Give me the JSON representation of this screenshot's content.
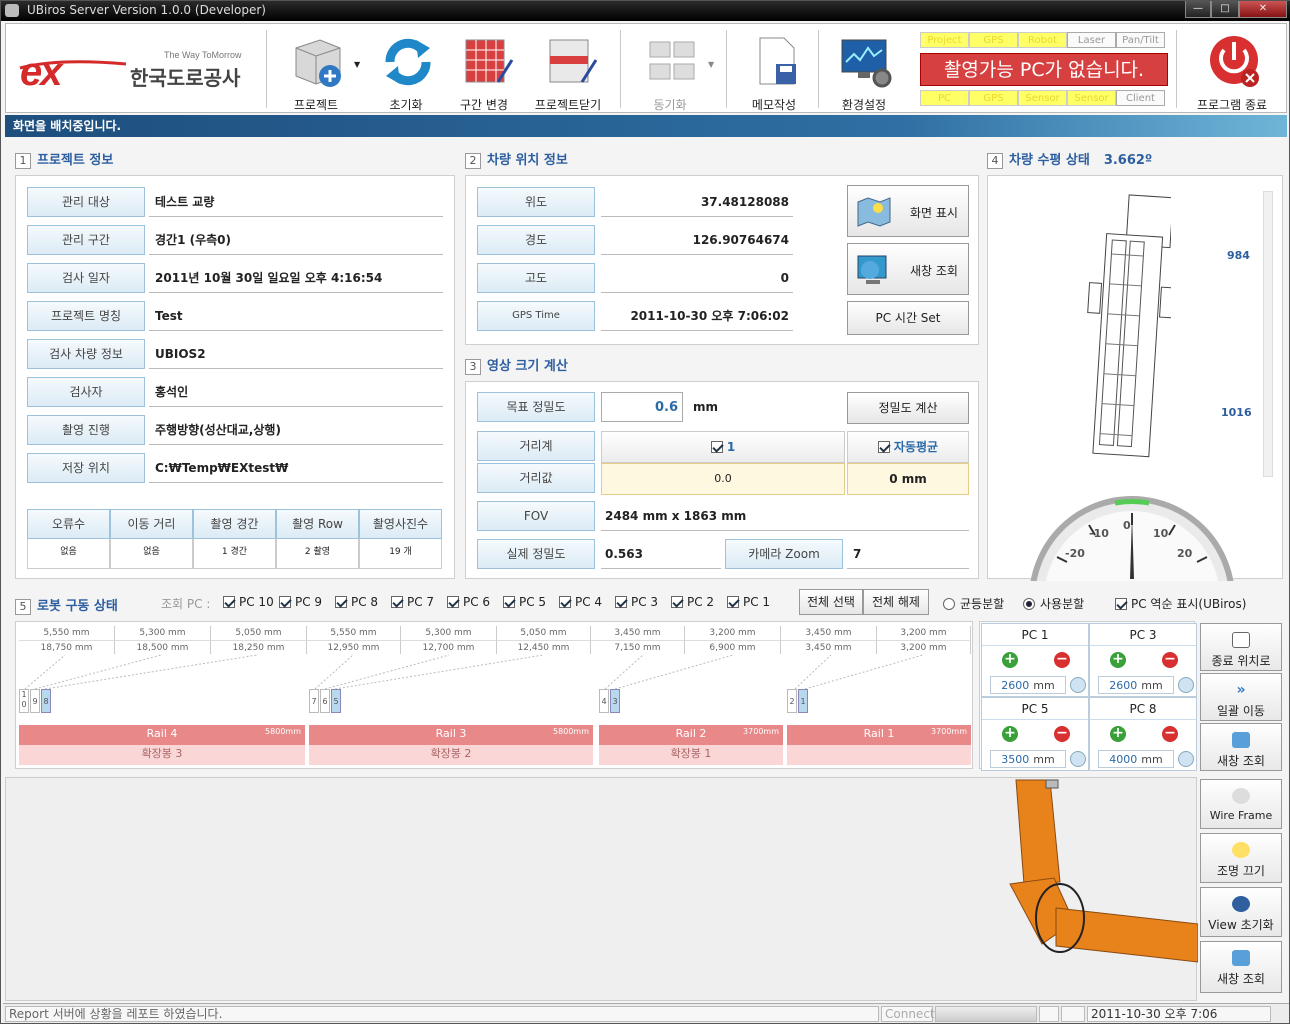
{
  "window": {
    "title": "UBiros Server Version 1.0.0 (Developer)",
    "min": "—",
    "max": "□",
    "close": "✕"
  },
  "logo": {
    "mark": "ex",
    "name": "한국도로공사",
    "tagline": "The Way ToMorrow"
  },
  "toolbar": {
    "project": "프로젝트",
    "reset": "초기화",
    "section_change": "구간 변경",
    "project_close": "프로젝트닫기",
    "sync": "동기화",
    "memo": "메모작성",
    "settings": "환경설정",
    "exit": "프로그램 종료"
  },
  "status_panel": {
    "top": [
      "Project",
      "GPS",
      "Robot",
      "Laser",
      "Pan/Tilt"
    ],
    "message": "촬영가능 PC가 없습니다.",
    "bottom": [
      "PC",
      "GPS",
      "Sensor",
      "Sensor",
      "Client"
    ]
  },
  "notice": "화면을 배치중입니다.",
  "s1": {
    "num": "1",
    "title": "프로젝트 정보",
    "rows": [
      {
        "label": "관리 대상",
        "value": "테스트 교량"
      },
      {
        "label": "관리 구간",
        "value": "경간1 (우측0)"
      },
      {
        "label": "검사 일자",
        "value": "2011년 10월 30일 일요일 오후 4:16:54"
      },
      {
        "label": "프로젝트 명칭",
        "value": "Test"
      },
      {
        "label": "검사 차량 정보",
        "value": "UBIOS2"
      },
      {
        "label": "검사자",
        "value": "홍석인"
      },
      {
        "label": "촬영 진행",
        "value": "주행방향(성산대교,상행)"
      },
      {
        "label": "저장 위치",
        "value": "C:₩Temp₩EXtest₩"
      }
    ],
    "table_headers": [
      "오류수",
      "이동 거리",
      "촬영 경간",
      "촬영 Row",
      "촬영사진수"
    ],
    "table_values": [
      "없음",
      "없음",
      "1 경간",
      "2 촬영",
      "19 개"
    ]
  },
  "s2": {
    "num": "2",
    "title": "차량 위치 정보",
    "rows": [
      {
        "label": "위도",
        "value": "37.48128088"
      },
      {
        "label": "경도",
        "value": "126.90764674"
      },
      {
        "label": "고도",
        "value": "0"
      },
      {
        "label": "GPS Time",
        "value": "2011-10-30 오후 7:06:02"
      }
    ],
    "btn_display": "화면 표시",
    "btn_refresh": "새창 조회",
    "btn_pctime": "PC 시간 Set"
  },
  "s3": {
    "num": "3",
    "title": "영상 크기 계산",
    "target_label": "목표 정밀도",
    "target_value": "0.6",
    "target_unit": "mm",
    "calc_button": "정밀도 계산",
    "range_label": "거리계",
    "range_check": "1",
    "auto_avg": "자동평균",
    "dist_label": "거리값",
    "dist_value": "0.0",
    "dist_mm": "0 mm",
    "fov_label": "FOV",
    "fov_value": "2484 mm x 1863 mm",
    "real_label": "실제 정밀도",
    "real_value": "0.563",
    "zoom_label": "카메라 Zoom",
    "zoom_value": "7"
  },
  "s4": {
    "num": "4",
    "title": "차량 수평 상태",
    "angle": "3.662º",
    "mark1": "984",
    "mark2": "1016",
    "gauge_ticks": [
      "-20",
      "-10",
      "0",
      "10",
      "20"
    ]
  },
  "s5": {
    "num": "5",
    "title": "로봇 구동 상태",
    "query_pc": "조회 PC :",
    "pcs": [
      "PC 10",
      "PC 9",
      "PC 8",
      "PC 7",
      "PC 6",
      "PC 5",
      "PC 4",
      "PC 3",
      "PC 2",
      "PC 1"
    ],
    "select_all": "전체 선택",
    "deselect_all": "전체 해제",
    "equal_split": "균등분할",
    "user_split": "사용분할",
    "reverse": "PC 역순 표시(UBiros)",
    "dist_top": [
      "5,550 mm",
      "5,300 mm",
      "5,050 mm",
      "5,550 mm",
      "5,300 mm",
      "5,050 mm",
      "3,450 mm",
      "3,200 mm",
      "3,450 mm",
      "3,200 mm"
    ],
    "dist_bot": [
      "18,750 mm",
      "18,500 mm",
      "18,250 mm",
      "12,950 mm",
      "12,700 mm",
      "12,450 mm",
      "7,150 mm",
      "6,900 mm",
      "3,450 mm",
      "3,200 mm"
    ],
    "rails": [
      {
        "name": "Rail 4",
        "len": "5800mm",
        "ext": "확장봉 3"
      },
      {
        "name": "Rail 3",
        "len": "5800mm",
        "ext": "확장봉 2"
      },
      {
        "name": "Rail 2",
        "len": "3700mm",
        "ext": "확장봉 1"
      },
      {
        "name": "Rail 1",
        "len": "3700mm",
        "ext": ""
      }
    ],
    "slots": [
      [
        "1 0",
        "9",
        "8"
      ],
      [
        "7",
        "6",
        "5"
      ],
      [
        "4",
        "3"
      ],
      [
        "2",
        "1"
      ]
    ],
    "pc_controls": [
      {
        "name": "PC 1",
        "mm": "2600"
      },
      {
        "name": "PC 3",
        "mm": "2600"
      },
      {
        "name": "PC 5",
        "mm": "3500"
      },
      {
        "name": "PC 8",
        "mm": "4000"
      }
    ],
    "unit": "mm"
  },
  "side": {
    "end_position": "종료 위치로",
    "batch_move": "일괄 이동",
    "new_window": "새창 조회",
    "wireframe": "Wire Frame",
    "light_off": "조명 끄기",
    "view_reset": "View 초기화",
    "new_window2": "새창 조회"
  },
  "statusbar": {
    "report": "Report 서버에 상황을 레포트 하였습니다.",
    "connect": "Connect",
    "datetime": "2011-10-30 오후 7:06"
  },
  "colors": {
    "accent": "#2d5fa0",
    "rail": "#e88888",
    "error": "#d64040",
    "status_yellow": "#ffff66",
    "arm": "#e8831c"
  }
}
